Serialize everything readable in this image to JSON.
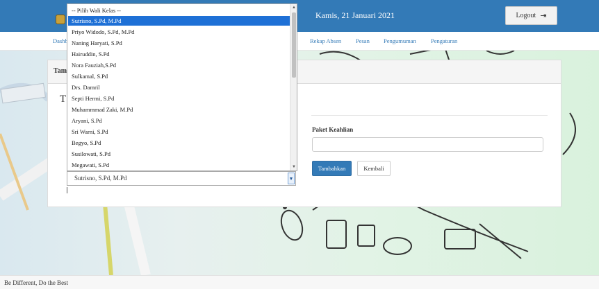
{
  "header": {
    "date": "Kamis, 21 Januari 2021",
    "logout_label": "Logout",
    "logout_icon": "sign-out-icon"
  },
  "nav": {
    "items": [
      {
        "label": "Dashb"
      },
      {
        "label": "Rekap Absen"
      },
      {
        "label": "Pesan"
      },
      {
        "label": "Pengumuman"
      },
      {
        "label": "Pengaturan"
      }
    ]
  },
  "panel": {
    "heading": "Tam",
    "form_title": "T",
    "paket_label": "Paket Keahlian",
    "paket_value": "",
    "add_button": "Tambahkan",
    "back_button": "Kembali"
  },
  "wali_select": {
    "selected": "Sutrisno, S.Pd, M.Pd",
    "options": [
      "-- Pilih Wali Kelas --",
      "Sutrisno, S.Pd, M.Pd",
      "Priyo Widodo, S.Pd, M.Pd",
      "Naning Haryati, S.Pd",
      "Hairuddin, S.Pd",
      "Nora Fauziah,S.Pd",
      "Sulkamal, S.Pd",
      "Drs. Damril",
      "Septi Hermi, S.Pd",
      "Muhammmad Zaki, M.Pd",
      "Aryani, S.Pd",
      "Sri Warni, S.Pd",
      "Begyo, S.Pd",
      "Susilowati, S.Pd",
      "Megawati, S.Pd"
    ],
    "highlighted_index": 1
  },
  "footer": {
    "tagline": "Be Different, Do the Best"
  },
  "colors": {
    "primary": "#337ab7",
    "highlight": "#1e70d6"
  }
}
